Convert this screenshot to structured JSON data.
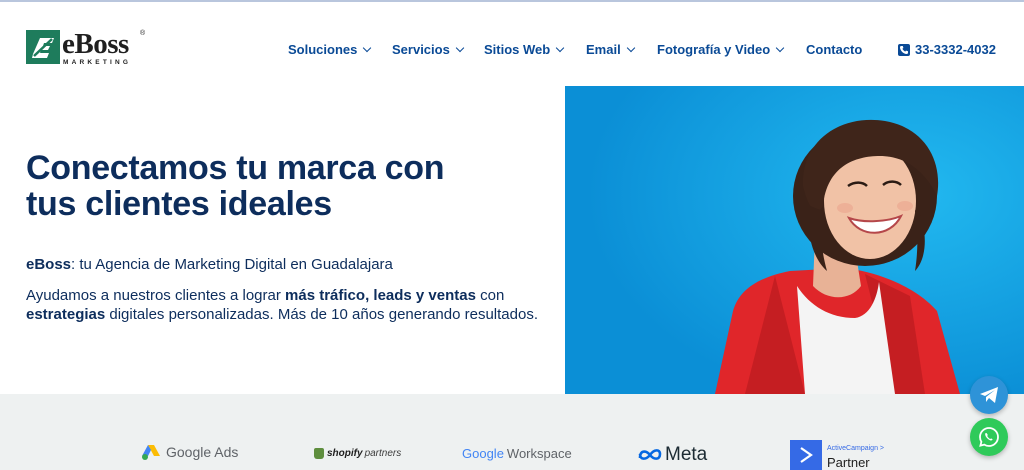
{
  "brand": {
    "name": "eBoss",
    "registered": "®",
    "tagline": "MARKETING"
  },
  "nav": {
    "items": [
      {
        "label": "Soluciones"
      },
      {
        "label": "Servicios"
      },
      {
        "label": "Sitios Web"
      },
      {
        "label": "Email"
      },
      {
        "label": "Fotografía y Video"
      },
      {
        "label": "Contacto"
      }
    ],
    "phone": "33-3332-4032"
  },
  "hero": {
    "title_line1": "Conectamos tu marca con",
    "title_line2": "tus clientes ideales",
    "subtitle_bold": "eBoss",
    "subtitle_rest": ": tu Agencia de Marketing Digital en Guadalajara",
    "body_1": "Ayudamos a nuestros clientes a lograr ",
    "body_bold_1": "más tráfico, leads y ventas",
    "body_2": " con",
    "body_bold_2": "estrategias",
    "body_3": " digitales personalizadas. Más de 10 años generando resultados."
  },
  "partners": {
    "google_ads": "Google Ads",
    "shopify_1": "shopify",
    "shopify_2": "partners",
    "google": "Google",
    "workspace": "Workspace",
    "meta": "Meta",
    "ac_top": "ActiveCampaign >",
    "ac_bottom": "Partner"
  },
  "colors": {
    "brand_blue": "#0a4a96",
    "heading_navy": "#0d2d5c",
    "hero_bg": "#0aa6e6",
    "jacket_red": "#e0262a",
    "partner_strip": "#eef1f1",
    "telegram": "#2e93d8",
    "whatsapp": "#2fca5a"
  },
  "icons": [
    "ebosslogo-icon",
    "chevron-down-icon",
    "phone-icon",
    "google-ads-icon",
    "shopify-bag-icon",
    "meta-infinity-icon",
    "activecampaign-icon",
    "telegram-icon",
    "whatsapp-icon"
  ]
}
